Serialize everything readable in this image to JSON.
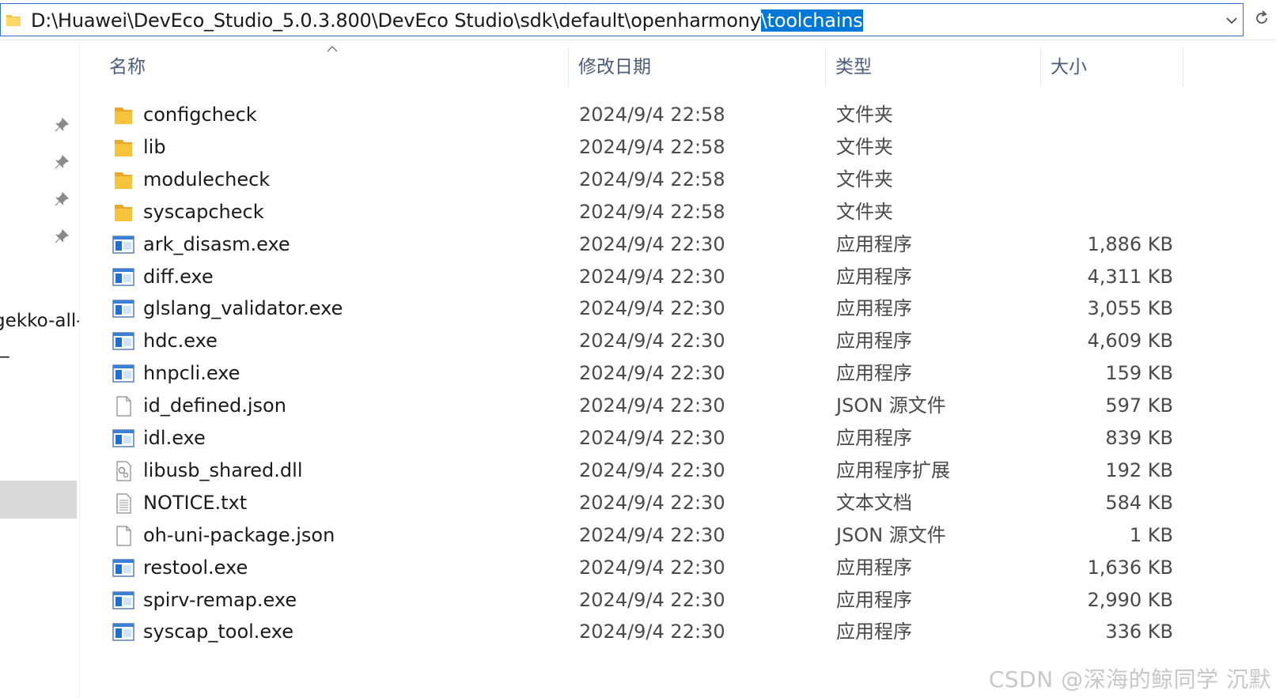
{
  "address_bar": {
    "path_prefix": "D:\\Huawei\\DevEco_Studio_5.0.3.800\\DevEco Studio\\sdk\\default\\openharmony",
    "path_selected": "\\toolchains"
  },
  "nav": {
    "fragment_1": "gekko-all-",
    "fragment_2": "_"
  },
  "columns": {
    "name": "名称",
    "modified": "修改日期",
    "type": "类型",
    "size": "大小"
  },
  "files": [
    {
      "name": "configcheck",
      "date": "2024/9/4 22:58",
      "type": "文件夹",
      "size": "",
      "icon": "folder-icon"
    },
    {
      "name": "lib",
      "date": "2024/9/4 22:58",
      "type": "文件夹",
      "size": "",
      "icon": "folder-icon"
    },
    {
      "name": "modulecheck",
      "date": "2024/9/4 22:58",
      "type": "文件夹",
      "size": "",
      "icon": "folder-icon"
    },
    {
      "name": "syscapcheck",
      "date": "2024/9/4 22:58",
      "type": "文件夹",
      "size": "",
      "icon": "folder-icon"
    },
    {
      "name": "ark_disasm.exe",
      "date": "2024/9/4 22:30",
      "type": "应用程序",
      "size": "1,886 KB",
      "icon": "exe-icon"
    },
    {
      "name": "diff.exe",
      "date": "2024/9/4 22:30",
      "type": "应用程序",
      "size": "4,311 KB",
      "icon": "exe-icon"
    },
    {
      "name": "glslang_validator.exe",
      "date": "2024/9/4 22:30",
      "type": "应用程序",
      "size": "3,055 KB",
      "icon": "exe-icon"
    },
    {
      "name": "hdc.exe",
      "date": "2024/9/4 22:30",
      "type": "应用程序",
      "size": "4,609 KB",
      "icon": "exe-icon"
    },
    {
      "name": "hnpcli.exe",
      "date": "2024/9/4 22:30",
      "type": "应用程序",
      "size": "159 KB",
      "icon": "exe-icon"
    },
    {
      "name": "id_defined.json",
      "date": "2024/9/4 22:30",
      "type": "JSON 源文件",
      "size": "597 KB",
      "icon": "file-icon"
    },
    {
      "name": "idl.exe",
      "date": "2024/9/4 22:30",
      "type": "应用程序",
      "size": "839 KB",
      "icon": "exe-icon"
    },
    {
      "name": "libusb_shared.dll",
      "date": "2024/9/4 22:30",
      "type": "应用程序扩展",
      "size": "192 KB",
      "icon": "dll-icon"
    },
    {
      "name": "NOTICE.txt",
      "date": "2024/9/4 22:30",
      "type": "文本文档",
      "size": "584 KB",
      "icon": "text-file-icon"
    },
    {
      "name": "oh-uni-package.json",
      "date": "2024/9/4 22:30",
      "type": "JSON 源文件",
      "size": "1 KB",
      "icon": "file-icon"
    },
    {
      "name": "restool.exe",
      "date": "2024/9/4 22:30",
      "type": "应用程序",
      "size": "1,636 KB",
      "icon": "exe-icon"
    },
    {
      "name": "spirv-remap.exe",
      "date": "2024/9/4 22:30",
      "type": "应用程序",
      "size": "2,990 KB",
      "icon": "exe-icon"
    },
    {
      "name": "syscap_tool.exe",
      "date": "2024/9/4 22:30",
      "type": "应用程序",
      "size": "336 KB",
      "icon": "exe-icon"
    }
  ],
  "watermark": "CSDN @深海的鲸同学 沉默",
  "colors": {
    "selection": "#0078d7",
    "folder": "#f8c33c",
    "exe_blue": "#1e6fd0",
    "header_text": "#4b5d7a"
  }
}
